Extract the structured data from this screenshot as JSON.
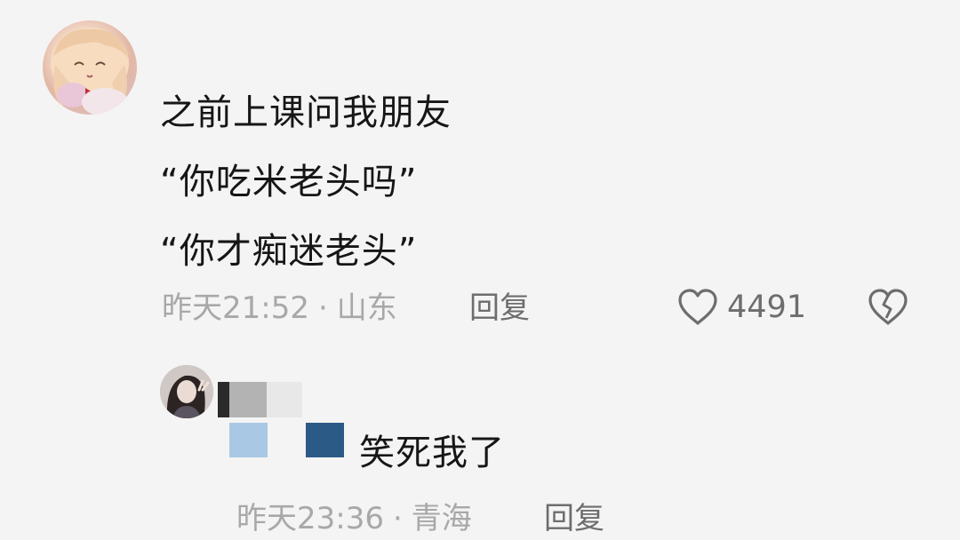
{
  "comment": {
    "lines": [
      "之前上课问我朋友",
      "“你吃米老头吗”",
      "“你才痴迷老头”"
    ],
    "time": "昨天21:52",
    "separator": "·",
    "location": "山东",
    "reply_label": "回复",
    "like_count": "4491",
    "icons": {
      "like": "heart-outline-icon",
      "dislike": "broken-heart-icon"
    }
  },
  "reply": {
    "text": "笑死我了",
    "time": "昨天23:36",
    "separator": "·",
    "location": "青海",
    "reply_label": "回复"
  },
  "colors": {
    "background": "#f4f4f4",
    "meta_text": "#a8a8a8",
    "action_text": "#6d6d6d",
    "redaction_dark_blue": "#2c5a86",
    "redaction_light_blue": "#a9c8e3",
    "redaction_gray": "#b3b3b3"
  }
}
